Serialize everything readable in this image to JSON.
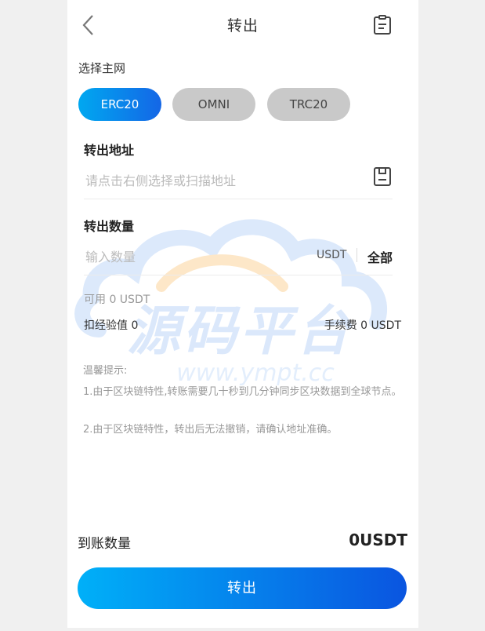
{
  "header": {
    "title": "转出",
    "back_icon": "chevron-left-icon",
    "record_icon": "clipboard-list-icon"
  },
  "network": {
    "label": "选择主网",
    "options": [
      {
        "label": "ERC20",
        "active": true
      },
      {
        "label": "OMNI",
        "active": false
      },
      {
        "label": "TRC20",
        "active": false
      }
    ]
  },
  "address": {
    "title": "转出地址",
    "placeholder": "请点击右侧选择或扫描地址",
    "book_icon": "address-book-icon"
  },
  "amount": {
    "title": "转出数量",
    "placeholder": "输入数量",
    "unit": "USDT",
    "all_label": "全部"
  },
  "balance": {
    "available": "可用 0 USDT",
    "deduct": "扣经验值 0",
    "fee": "手续费 0 USDT"
  },
  "tips": {
    "title": "温馨提示:",
    "items": [
      "1.由于区块链特性,转账需要几十秒到几分钟同步区块数据到全球节点。",
      "2.由于区块链特性，转出后无法撤销，请确认地址准确。"
    ]
  },
  "receive": {
    "label": "到账数量",
    "value": "0USDT"
  },
  "submit_label": "转出",
  "watermark": {
    "text": "源码平台",
    "url": "www.ympt.cc"
  },
  "colors": {
    "accent_start": "#00a8f0",
    "accent_end": "#1466e6",
    "chip_inactive": "#c9c9c9"
  }
}
